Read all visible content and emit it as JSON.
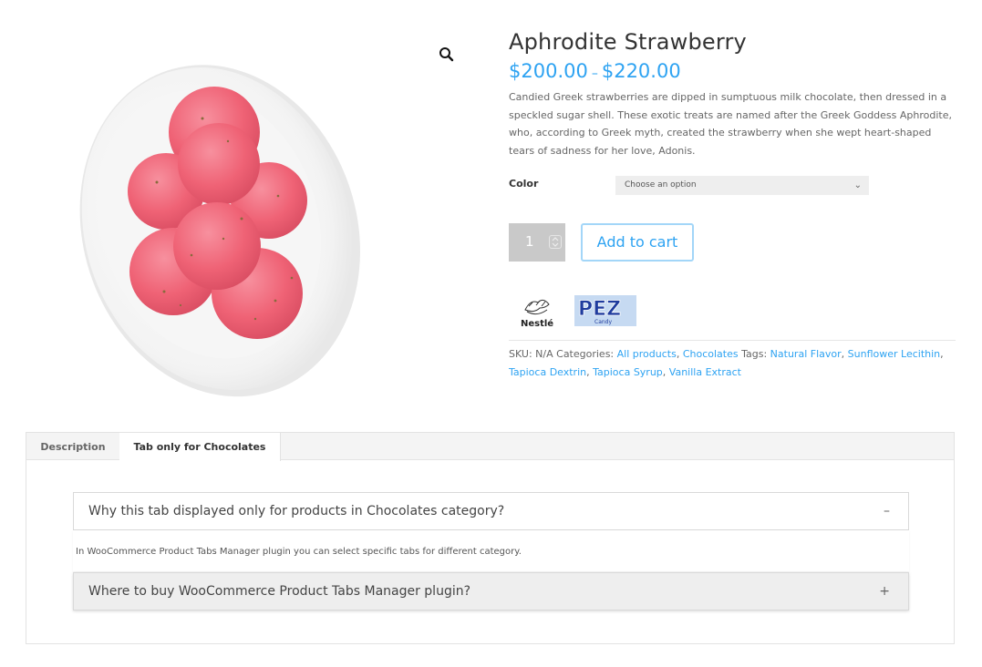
{
  "product": {
    "title": "Aphrodite Strawberry",
    "price_low": "$200.00",
    "price_sep": "–",
    "price_high": "$220.00",
    "description": "Candied Greek strawberries are dipped in sumptuous milk chocolate, then dressed in a speckled sugar shell. These exotic treats are named after the Greek Goddess Aphrodite, who, according to Greek myth, created the strawberry when she wept heart-shaped tears of sadness for her love, Adonis.",
    "image_icon": "candy-bowl-image",
    "zoom_icon": "magnifier-icon"
  },
  "variations": {
    "label": "Color",
    "select_value": "Choose an option",
    "chevron": "⌄"
  },
  "cart": {
    "quantity": "1",
    "spinner": "⌃⌄",
    "add_label": "Add to cart"
  },
  "brands": {
    "nestle_text": "Nestlé",
    "pez_text": "PEZ",
    "pez_sub": "Candy"
  },
  "meta": {
    "sku_label": "SKU:",
    "sku_value": "N/A",
    "categories_label": "Categories:",
    "categories": [
      "All products",
      "Chocolates"
    ],
    "tags_label": "Tags:",
    "tags": [
      "Natural Flavor",
      "Sunflower Lecithin",
      "Tapioca Dextrin",
      "Tapioca Syrup",
      "Vanilla Extract"
    ],
    "sep": ", "
  },
  "tabs": {
    "items": [
      "Description",
      "Tab only for Chocolates"
    ],
    "accordion": [
      {
        "title": "Why this tab displayed only for products in Chocolates category?",
        "sign": "–",
        "body": "In WooCommerce Product Tabs Manager plugin you can select specific tabs for different category."
      },
      {
        "title": "Where to buy WooCommerce Product Tabs Manager plugin?",
        "sign": "+"
      }
    ]
  },
  "colors": {
    "accent": "#2ea3f2",
    "candy": "#f0637a",
    "bowl": "#f4f4f4"
  }
}
